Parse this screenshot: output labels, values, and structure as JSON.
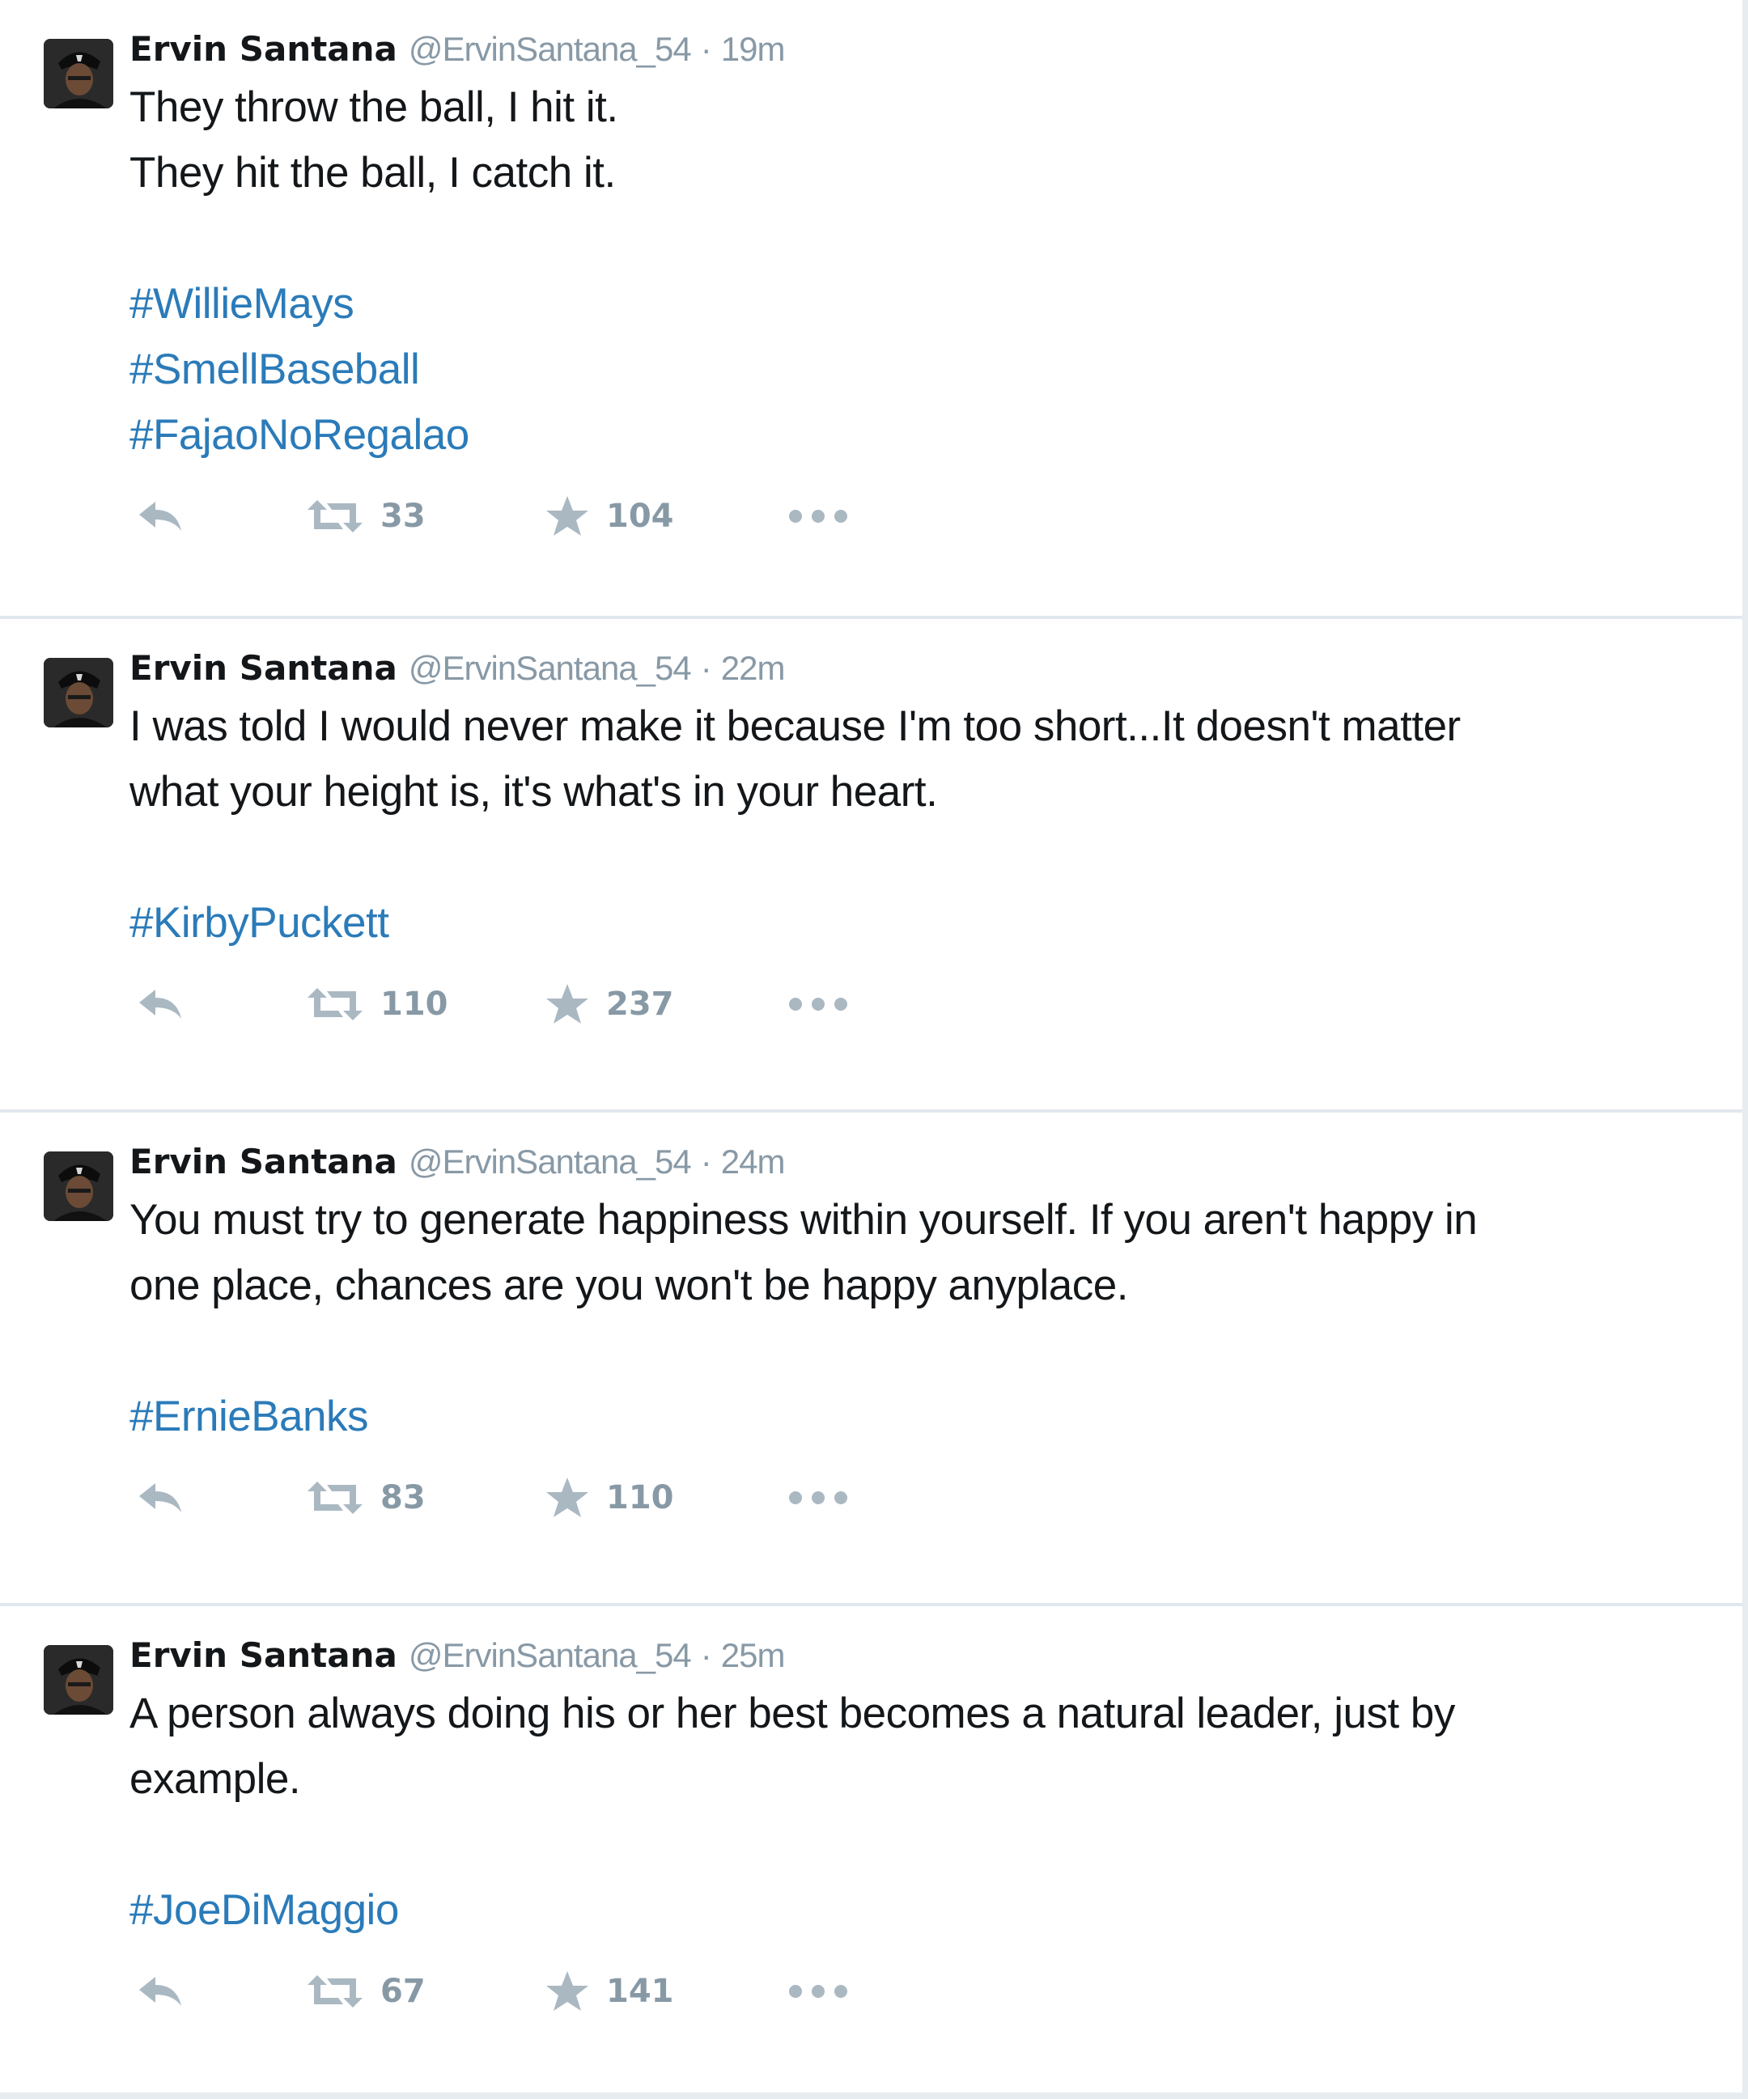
{
  "tweets": [
    {
      "fullname": "Ervin Santana",
      "username": "@ErvinSantana_54",
      "separator": "·",
      "time": "19m",
      "text_lines": [
        "They throw the ball, I hit it.",
        "They hit the ball, I catch it."
      ],
      "hashtags": [
        "#WillieMays",
        "#SmellBaseball",
        "#FajaoNoRegalao"
      ],
      "retweets": "33",
      "favorites": "104"
    },
    {
      "fullname": "Ervin Santana",
      "username": "@ErvinSantana_54",
      "separator": "·",
      "time": "22m",
      "text_lines": [
        "I was told I would never make it because I'm too short...It doesn't matter",
        "what your height is, it's what's in your heart."
      ],
      "hashtags": [
        "#KirbyPuckett"
      ],
      "retweets": "110",
      "favorites": "237"
    },
    {
      "fullname": "Ervin Santana",
      "username": "@ErvinSantana_54",
      "separator": "·",
      "time": "24m",
      "text_lines": [
        "You must try to generate happiness within yourself. If you aren't happy in",
        "one place, chances are you won't be happy anyplace."
      ],
      "hashtags": [
        "#ErnieBanks"
      ],
      "retweets": "83",
      "favorites": "110"
    },
    {
      "fullname": "Ervin Santana",
      "username": "@ErvinSantana_54",
      "separator": "·",
      "time": "25m",
      "text_lines": [
        "A person always doing his or her best becomes a natural leader, just by",
        "example."
      ],
      "hashtags": [
        "#JoeDiMaggio"
      ],
      "retweets": "67",
      "favorites": "141"
    }
  ],
  "icons": {
    "reply": "reply-icon",
    "retweet": "retweet-icon",
    "favorite": "star-icon",
    "more": "more-dots-icon"
  },
  "colors": {
    "text": "#14171a",
    "muted": "#8899a6",
    "hashtag": "#2b7bb9",
    "divider": "#e1e8ed",
    "icon": "#aab8c2"
  }
}
